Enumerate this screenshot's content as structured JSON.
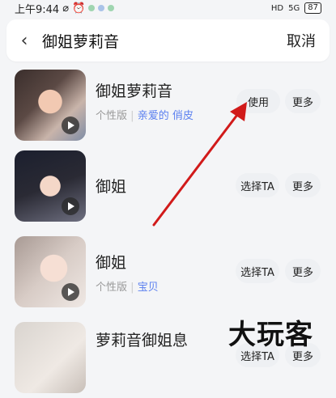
{
  "status": {
    "time": "上午9:44",
    "signal": "5G",
    "battery": "87"
  },
  "search": {
    "query": "御姐萝莉音",
    "cancel_label": "取消"
  },
  "results": [
    {
      "name": "御姐萝莉音",
      "edition": "个性版",
      "tags": "亲爱的 俏皮",
      "primary_label": "使用",
      "more_label": "更多"
    },
    {
      "name": "御姐",
      "edition": "",
      "tags": "",
      "primary_label": "选择TA",
      "more_label": "更多"
    },
    {
      "name": "御姐",
      "edition": "个性版",
      "tags": "宝贝",
      "primary_label": "选择TA",
      "more_label": "更多"
    },
    {
      "name": "萝莉音御姐息",
      "edition": "",
      "tags": "",
      "primary_label": "选择TA",
      "more_label": "更多"
    }
  ],
  "watermark": "大玩客",
  "colors": {
    "tag_blue": "#5a7ff0",
    "annotation_red": "#d11a1a"
  }
}
